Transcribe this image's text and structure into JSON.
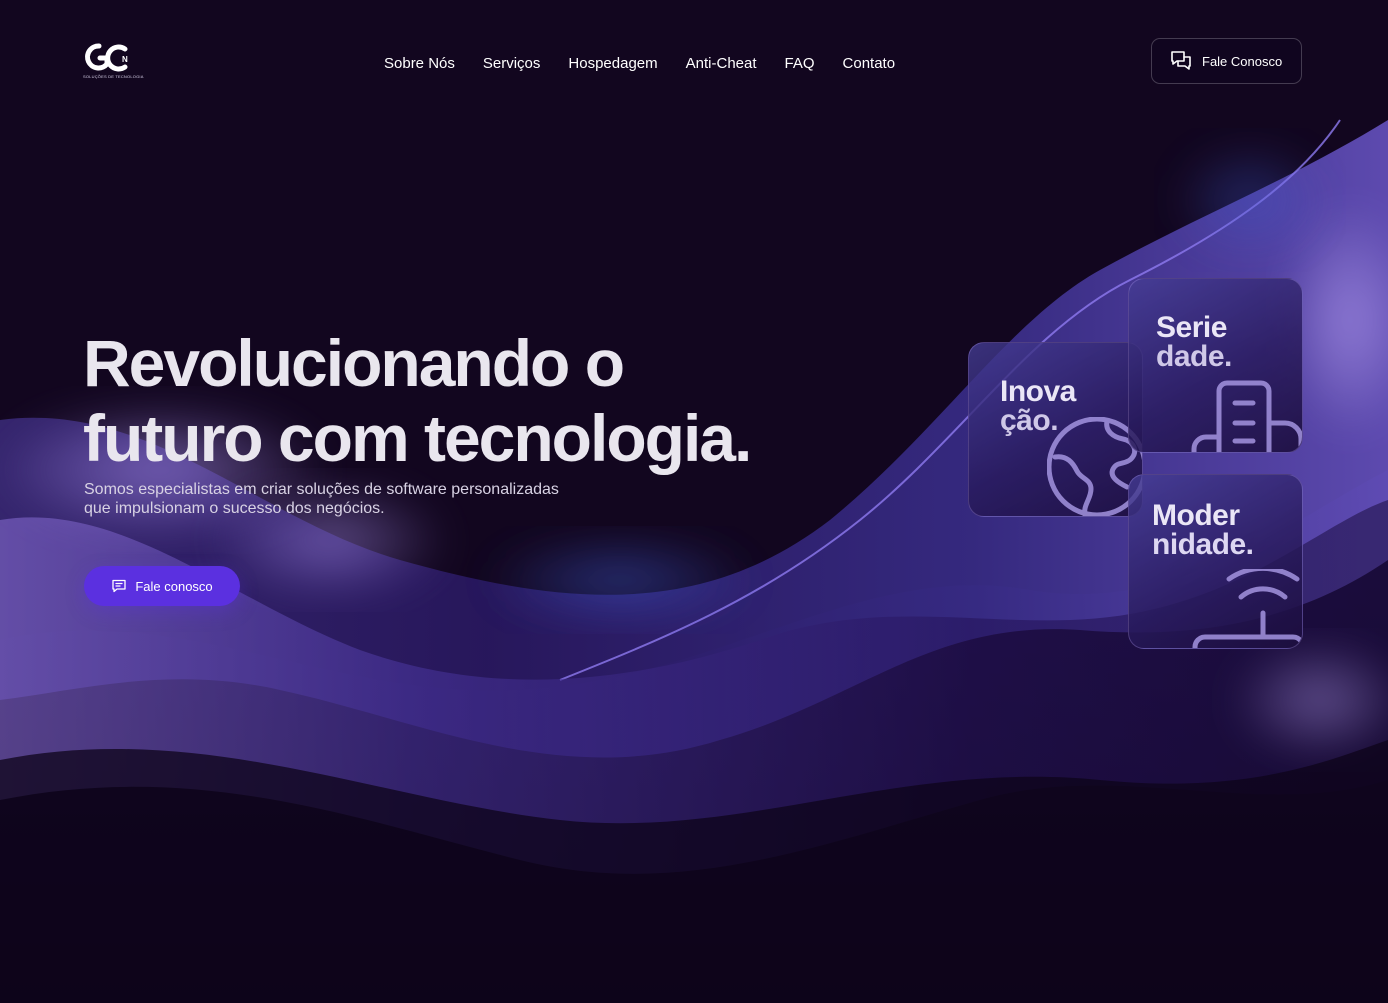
{
  "brand": {
    "logo_caption": "SOLUÇÕES DE TECNOLOGIA"
  },
  "nav": {
    "items": [
      {
        "label": "Sobre Nós"
      },
      {
        "label": "Serviços"
      },
      {
        "label": "Hospedagem"
      },
      {
        "label": "Anti-Cheat"
      },
      {
        "label": "FAQ"
      },
      {
        "label": "Contato"
      }
    ]
  },
  "header": {
    "cta_label": "Fale Conosco",
    "cta_icon": "chat-bubbles-icon"
  },
  "hero": {
    "title_line1": "Revolucionando o",
    "title_line2": "futuro com tecnologia.",
    "subtitle_line1": "Somos especialistas em criar soluções de software personalizadas",
    "subtitle_line2": "que impulsionam o sucesso dos negócios.",
    "cta_label": "Fale conosco",
    "cta_icon": "message-icon"
  },
  "cards": [
    {
      "line1": "Inova",
      "line2": "ção.",
      "icon": "globe-icon"
    },
    {
      "line1": "Serie",
      "line2": "dade.",
      "icon": "building-icon"
    },
    {
      "line1": "Moder",
      "line2": "nidade.",
      "icon": "wifi-router-icon"
    }
  ],
  "colors": {
    "background": "#12061f",
    "accent": "#5b30e0",
    "text": "#ffffff"
  }
}
